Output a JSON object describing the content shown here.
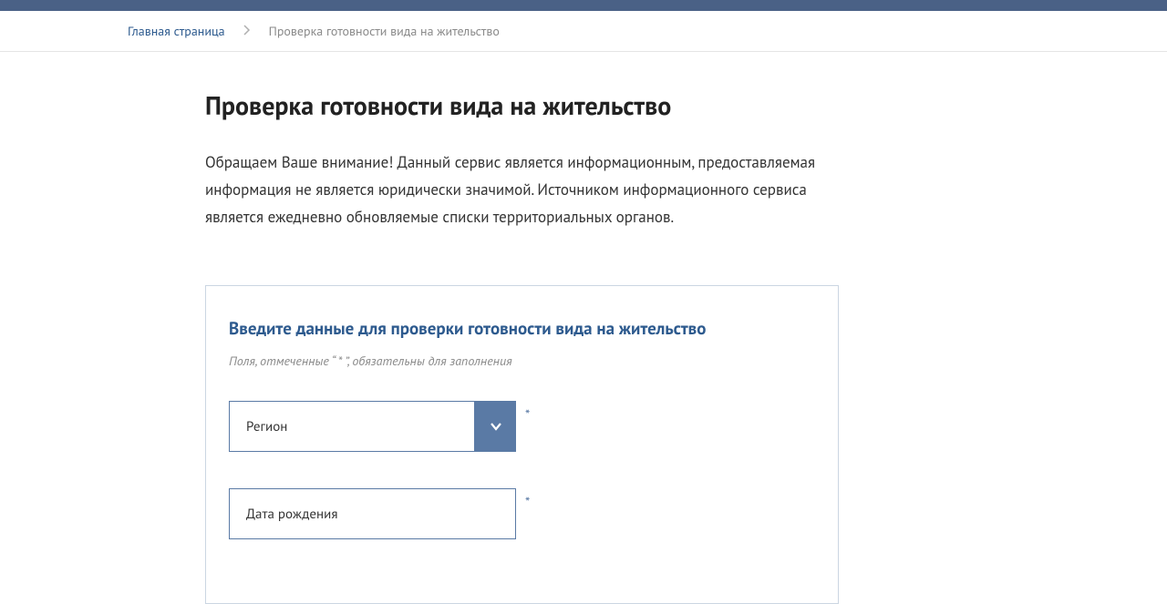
{
  "breadcrumb": {
    "home": "Главная страница",
    "current": "Проверка готовности вида на жительство"
  },
  "page": {
    "title": "Проверка готовности вида на жительство",
    "intro": "Обращаем Ваше внимание! Данный сервис является информационным, предоставляемая информация не является юридически значимой. Источником информационного сервиса является ежедневно обновляемые списки территориальных органов."
  },
  "form": {
    "title": "Введите данные для проверки готовности вида на жительство",
    "hint": "Поля, отмеченные “ * ”, обязательны для заполнения",
    "region_label": "Регион",
    "dob_placeholder": "Дата рождения",
    "required_mark": "*"
  },
  "colors": {
    "topbar": "#4a6186",
    "accent": "#2d5a8e",
    "field_border": "#5a7aa5"
  }
}
